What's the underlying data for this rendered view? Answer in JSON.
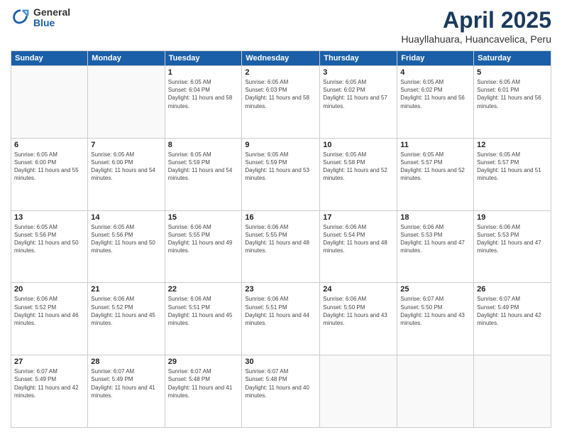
{
  "logo": {
    "general": "General",
    "blue": "Blue"
  },
  "header": {
    "title": "April 2025",
    "subtitle": "Huayllahuara, Huancavelica, Peru"
  },
  "weekdays": [
    "Sunday",
    "Monday",
    "Tuesday",
    "Wednesday",
    "Thursday",
    "Friday",
    "Saturday"
  ],
  "weeks": [
    [
      {
        "day": "",
        "info": ""
      },
      {
        "day": "",
        "info": ""
      },
      {
        "day": "1",
        "info": "Sunrise: 6:05 AM\nSunset: 6:04 PM\nDaylight: 11 hours and 58 minutes."
      },
      {
        "day": "2",
        "info": "Sunrise: 6:05 AM\nSunset: 6:03 PM\nDaylight: 11 hours and 58 minutes."
      },
      {
        "day": "3",
        "info": "Sunrise: 6:05 AM\nSunset: 6:02 PM\nDaylight: 11 hours and 57 minutes."
      },
      {
        "day": "4",
        "info": "Sunrise: 6:05 AM\nSunset: 6:02 PM\nDaylight: 11 hours and 56 minutes."
      },
      {
        "day": "5",
        "info": "Sunrise: 6:05 AM\nSunset: 6:01 PM\nDaylight: 11 hours and 56 minutes."
      }
    ],
    [
      {
        "day": "6",
        "info": "Sunrise: 6:05 AM\nSunset: 6:00 PM\nDaylight: 11 hours and 55 minutes."
      },
      {
        "day": "7",
        "info": "Sunrise: 6:05 AM\nSunset: 6:00 PM\nDaylight: 11 hours and 54 minutes."
      },
      {
        "day": "8",
        "info": "Sunrise: 6:05 AM\nSunset: 5:59 PM\nDaylight: 11 hours and 54 minutes."
      },
      {
        "day": "9",
        "info": "Sunrise: 6:05 AM\nSunset: 5:59 PM\nDaylight: 11 hours and 53 minutes."
      },
      {
        "day": "10",
        "info": "Sunrise: 6:05 AM\nSunset: 5:58 PM\nDaylight: 11 hours and 52 minutes."
      },
      {
        "day": "11",
        "info": "Sunrise: 6:05 AM\nSunset: 5:57 PM\nDaylight: 11 hours and 52 minutes."
      },
      {
        "day": "12",
        "info": "Sunrise: 6:05 AM\nSunset: 5:57 PM\nDaylight: 11 hours and 51 minutes."
      }
    ],
    [
      {
        "day": "13",
        "info": "Sunrise: 6:05 AM\nSunset: 5:56 PM\nDaylight: 11 hours and 50 minutes."
      },
      {
        "day": "14",
        "info": "Sunrise: 6:05 AM\nSunset: 5:56 PM\nDaylight: 11 hours and 50 minutes."
      },
      {
        "day": "15",
        "info": "Sunrise: 6:06 AM\nSunset: 5:55 PM\nDaylight: 11 hours and 49 minutes."
      },
      {
        "day": "16",
        "info": "Sunrise: 6:06 AM\nSunset: 5:55 PM\nDaylight: 11 hours and 48 minutes."
      },
      {
        "day": "17",
        "info": "Sunrise: 6:06 AM\nSunset: 5:54 PM\nDaylight: 11 hours and 48 minutes."
      },
      {
        "day": "18",
        "info": "Sunrise: 6:06 AM\nSunset: 5:53 PM\nDaylight: 11 hours and 47 minutes."
      },
      {
        "day": "19",
        "info": "Sunrise: 6:06 AM\nSunset: 5:53 PM\nDaylight: 11 hours and 47 minutes."
      }
    ],
    [
      {
        "day": "20",
        "info": "Sunrise: 6:06 AM\nSunset: 5:52 PM\nDaylight: 11 hours and 46 minutes."
      },
      {
        "day": "21",
        "info": "Sunrise: 6:06 AM\nSunset: 5:52 PM\nDaylight: 11 hours and 45 minutes."
      },
      {
        "day": "22",
        "info": "Sunrise: 6:06 AM\nSunset: 5:51 PM\nDaylight: 11 hours and 45 minutes."
      },
      {
        "day": "23",
        "info": "Sunrise: 6:06 AM\nSunset: 5:51 PM\nDaylight: 11 hours and 44 minutes."
      },
      {
        "day": "24",
        "info": "Sunrise: 6:06 AM\nSunset: 5:50 PM\nDaylight: 11 hours and 43 minutes."
      },
      {
        "day": "25",
        "info": "Sunrise: 6:07 AM\nSunset: 5:50 PM\nDaylight: 11 hours and 43 minutes."
      },
      {
        "day": "26",
        "info": "Sunrise: 6:07 AM\nSunset: 5:49 PM\nDaylight: 11 hours and 42 minutes."
      }
    ],
    [
      {
        "day": "27",
        "info": "Sunrise: 6:07 AM\nSunset: 5:49 PM\nDaylight: 11 hours and 42 minutes."
      },
      {
        "day": "28",
        "info": "Sunrise: 6:07 AM\nSunset: 5:49 PM\nDaylight: 11 hours and 41 minutes."
      },
      {
        "day": "29",
        "info": "Sunrise: 6:07 AM\nSunset: 5:48 PM\nDaylight: 11 hours and 41 minutes."
      },
      {
        "day": "30",
        "info": "Sunrise: 6:07 AM\nSunset: 5:48 PM\nDaylight: 11 hours and 40 minutes."
      },
      {
        "day": "",
        "info": ""
      },
      {
        "day": "",
        "info": ""
      },
      {
        "day": "",
        "info": ""
      }
    ]
  ]
}
